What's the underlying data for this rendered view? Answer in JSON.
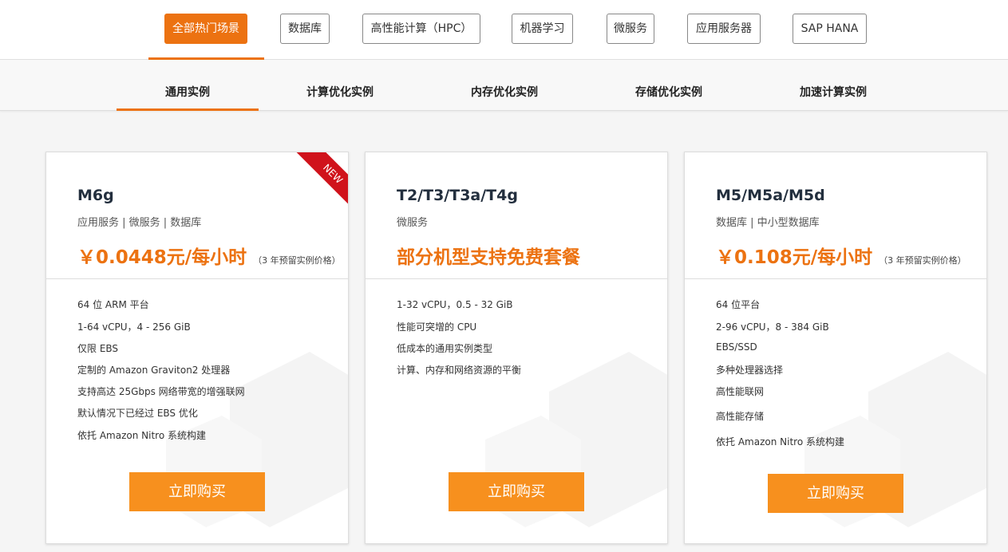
{
  "scenario_tabs": [
    {
      "label": "全部热门场景",
      "active": true
    },
    {
      "label": "数据库",
      "active": false
    },
    {
      "label": "高性能计算（HPC）",
      "active": false
    },
    {
      "label": "机器学习",
      "active": false
    },
    {
      "label": "微服务",
      "active": false
    },
    {
      "label": "应用服务器",
      "active": false
    },
    {
      "label": "SAP HANA",
      "active": false
    }
  ],
  "category_tabs": [
    {
      "label": "通用实例",
      "active": true
    },
    {
      "label": "计算优化实例",
      "active": false
    },
    {
      "label": "内存优化实例",
      "active": false
    },
    {
      "label": "存储优化实例",
      "active": false
    },
    {
      "label": "加速计算实例",
      "active": false
    }
  ],
  "cards": [
    {
      "title": "M6g",
      "subtitle": "应用服务 | 微服务 | 数据库",
      "price": "￥0.0448元/每小时",
      "price_note": "（3 年预留实例价格）",
      "badge": "NEW",
      "features": [
        "64 位 ARM 平台",
        "1-64 vCPU，4 - 256 GiB",
        "仅限 EBS",
        "定制的 Amazon Graviton2 处理器",
        "支持高达 25Gbps 网络带宽的增强联网",
        "默认情况下已经过 EBS 优化",
        "依托 Amazon Nitro 系统构建"
      ],
      "button": "立即购买"
    },
    {
      "title": "T2/T3/T3a/T4g",
      "subtitle": "微服务",
      "price": "部分机型支持免费套餐",
      "price_note": "",
      "features": [
        "1-32 vCPU，0.5 - 32 GiB",
        "性能可突增的 CPU",
        "低成本的通用实例类型",
        "计算、内存和网络资源的平衡"
      ],
      "button": "立即购买"
    },
    {
      "title": "M5/M5a/M5d",
      "subtitle": "数据库 | 中小型数据库",
      "price": "￥0.108元/每小时",
      "price_note": "（3 年预留实例价格）",
      "features": [
        "64 位平台",
        "2-96 vCPU，8 - 384 GiB",
        "EBS/SSD",
        "多种处理器选择",
        "高性能联网",
        "高性能存储",
        "依托 Amazon Nitro 系统构建"
      ],
      "button": "立即购买"
    }
  ],
  "colors": {
    "accent": "#ec7211",
    "button": "#f7901e",
    "ribbon": "#d0121b"
  }
}
